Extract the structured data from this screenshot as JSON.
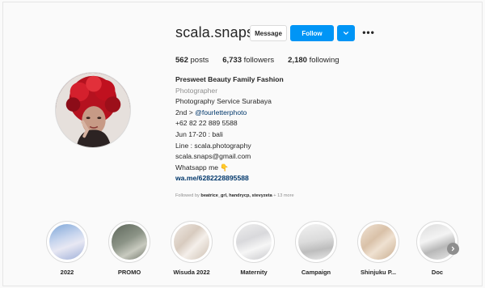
{
  "profile": {
    "username": "scala.snaps",
    "message_label": "Message",
    "follow_label": "Follow",
    "more_label": "•••"
  },
  "stats": {
    "posts_count": "562",
    "posts_label": "posts",
    "followers_count": "6,733",
    "followers_label": "followers",
    "following_count": "2,180",
    "following_label": "following"
  },
  "bio": {
    "name": "Presweet Beauty Family Fashion",
    "category": "Photographer",
    "line1": "Photography Service Surabaya",
    "line2_prefix": "2nd > ",
    "line2_mention": "@fourletterphoto",
    "line3": "+62 82 22 889 5588",
    "line4": "Jun 17-20 : bali",
    "line5": "Line : scala.photography",
    "line6": "scala.snaps@gmail.com",
    "line7": "Whatsapp me 👇",
    "link": "wa.me/6282228895588"
  },
  "followed_by": {
    "prefix": "Followed by ",
    "users": "beatrice_grl, handrycp, stevyzeta",
    "suffix": " + 13 more"
  },
  "highlights": [
    {
      "label": "2022"
    },
    {
      "label": "PROMO"
    },
    {
      "label": "Wisuda 2022"
    },
    {
      "label": "Maternity"
    },
    {
      "label": "Campaign"
    },
    {
      "label": "Shinjuku P..."
    },
    {
      "label": "Doc"
    }
  ],
  "colors": {
    "accent": "#0095f6",
    "link": "#00376b",
    "muted": "#8e8e8e",
    "text": "#262626"
  },
  "icons": {
    "dropdown": "chevron-down-icon",
    "more": "more-options-icon",
    "next": "chevron-right-icon"
  }
}
